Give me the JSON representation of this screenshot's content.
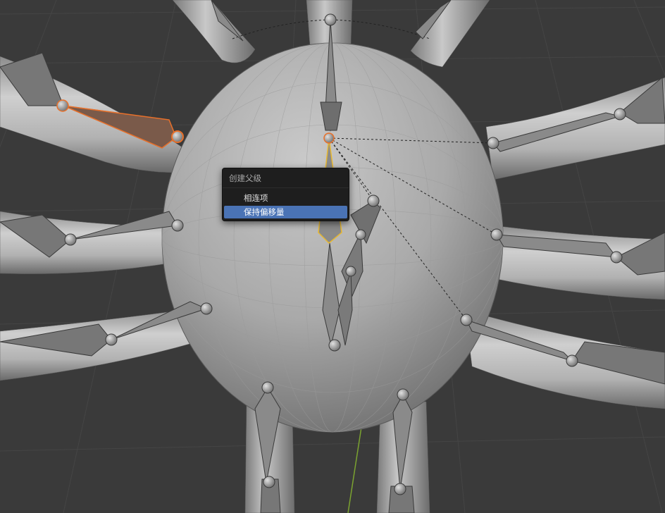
{
  "menu": {
    "title": "创建父级",
    "items": [
      {
        "label": "相连项",
        "highlighted": false
      },
      {
        "label": "保持偏移量",
        "highlighted": true
      }
    ],
    "highlight_color": "#4a73b5"
  },
  "viewport": {
    "background_color": "#3a3a3a",
    "selection_outline_color": "#e8702a",
    "active_bone_outline_color": "#e8b830",
    "y_axis_color": "#7ba330"
  }
}
